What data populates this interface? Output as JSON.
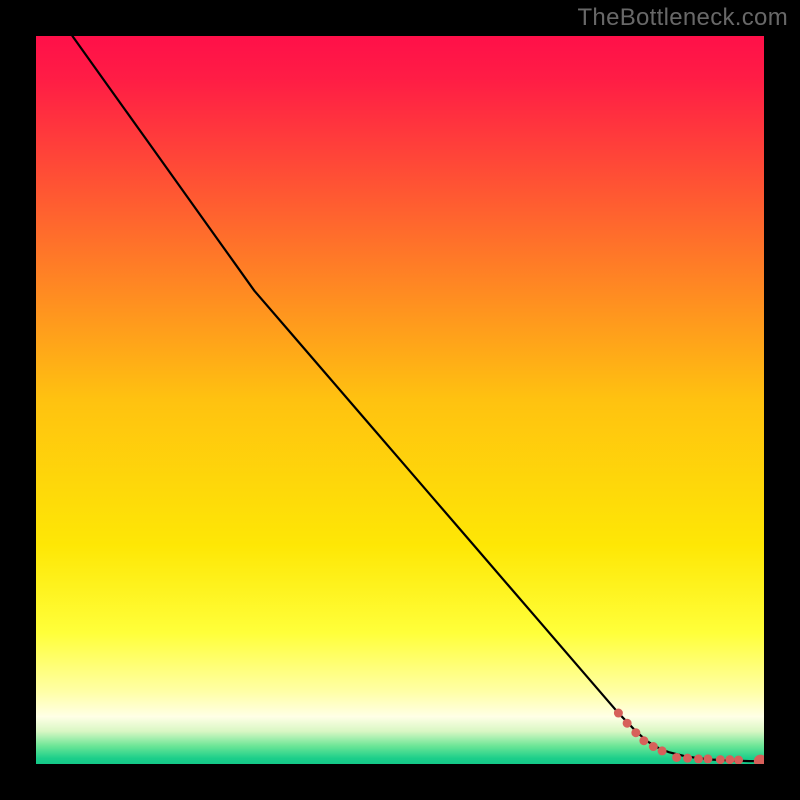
{
  "watermark": "TheBottleneck.com",
  "chart_data": {
    "type": "line",
    "title": "",
    "xlabel": "",
    "ylabel": "",
    "xlim": [
      0,
      100
    ],
    "ylim": [
      0,
      100
    ],
    "grid": false,
    "legend": false,
    "background_gradient": {
      "stops": [
        {
          "offset": 0.0,
          "color": "#FF1049"
        },
        {
          "offset": 0.06,
          "color": "#FF1D45"
        },
        {
          "offset": 0.5,
          "color": "#FFC210"
        },
        {
          "offset": 0.7,
          "color": "#FEE705"
        },
        {
          "offset": 0.82,
          "color": "#FFFF3A"
        },
        {
          "offset": 0.9,
          "color": "#FFFFA5"
        },
        {
          "offset": 0.935,
          "color": "#FFFFE6"
        },
        {
          "offset": 0.955,
          "color": "#D9F7C4"
        },
        {
          "offset": 0.975,
          "color": "#6DE697"
        },
        {
          "offset": 0.992,
          "color": "#1DCF8A"
        },
        {
          "offset": 1.0,
          "color": "#13C888"
        }
      ]
    },
    "series": [
      {
        "name": "bottleneck-curve",
        "color": "#000000",
        "x": [
          5,
          10,
          15,
          20,
          25,
          27.5,
          30,
          35,
          40,
          45,
          50,
          55,
          60,
          65,
          70,
          75,
          80,
          82.5,
          84,
          85.5,
          87,
          89,
          91,
          93,
          95,
          96.5,
          98,
          99.5
        ],
        "y": [
          100,
          93,
          86,
          79,
          72,
          68.5,
          65,
          59.2,
          53.4,
          47.6,
          41.8,
          36,
          30.2,
          24.4,
          18.6,
          12.8,
          7,
          4.4,
          3.1,
          2.2,
          1.6,
          1.1,
          0.8,
          0.6,
          0.5,
          0.45,
          0.4,
          0.4
        ]
      }
    ],
    "points": {
      "name": "measurement-points",
      "color": "#D7605A",
      "radius_small": 4.5,
      "radius_large": 6.5,
      "coords": [
        {
          "x": 80.0,
          "y": 7.0,
          "r": "s"
        },
        {
          "x": 81.2,
          "y": 5.6,
          "r": "s"
        },
        {
          "x": 82.4,
          "y": 4.3,
          "r": "s"
        },
        {
          "x": 83.5,
          "y": 3.2,
          "r": "s"
        },
        {
          "x": 84.8,
          "y": 2.4,
          "r": "s"
        },
        {
          "x": 86.0,
          "y": 1.8,
          "r": "s"
        },
        {
          "x": 88.0,
          "y": 0.9,
          "r": "s"
        },
        {
          "x": 89.5,
          "y": 0.8,
          "r": "s"
        },
        {
          "x": 91.0,
          "y": 0.7,
          "r": "s"
        },
        {
          "x": 92.3,
          "y": 0.7,
          "r": "s"
        },
        {
          "x": 94.0,
          "y": 0.6,
          "r": "s"
        },
        {
          "x": 95.3,
          "y": 0.6,
          "r": "s"
        },
        {
          "x": 96.5,
          "y": 0.55,
          "r": "s"
        },
        {
          "x": 99.5,
          "y": 0.4,
          "r": "l"
        }
      ]
    }
  }
}
